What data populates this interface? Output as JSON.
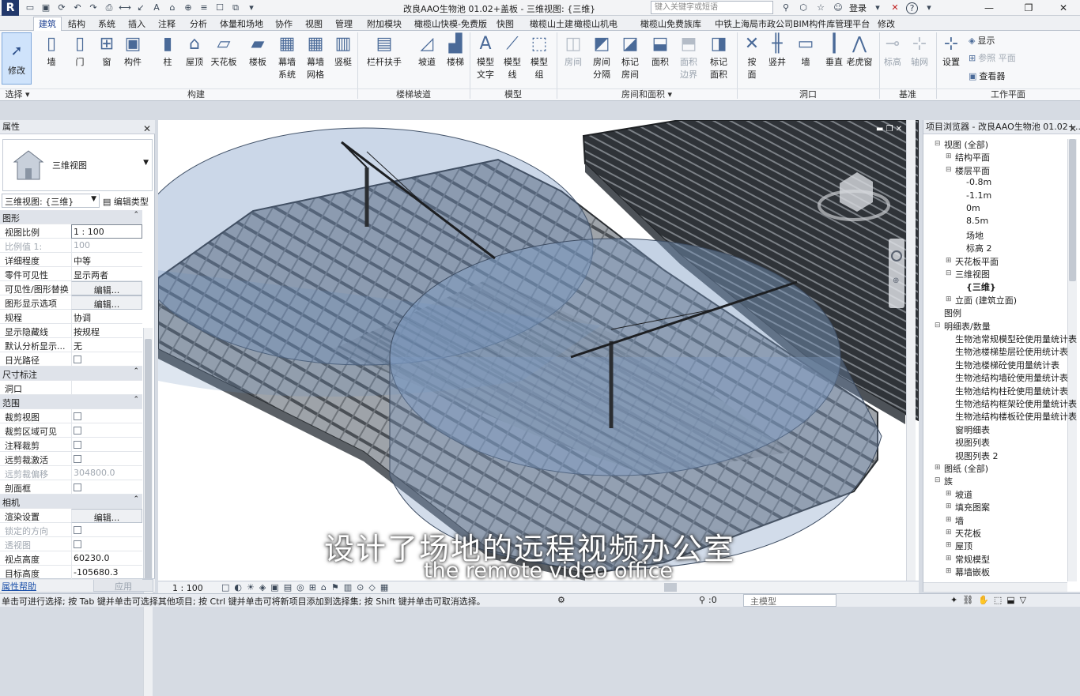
{
  "titlebar": {
    "app_letter": "R",
    "doc_title": "改良AAO生物池    01.02+盖板 - 三维视图: {三维}",
    "search_placeholder": "键入关键字或短语",
    "login": "登录",
    "help": "?"
  },
  "tabs": [
    "建筑",
    "结构",
    "系统",
    "插入",
    "注释",
    "分析",
    "体量和场地",
    "协作",
    "视图",
    "管理",
    "附加模块",
    "橄榄山快模-免费版",
    "快图",
    "橄榄山土建",
    "橄榄山机电",
    "橄榄山免费族库",
    "中铁上海局市政公司BIM构件库管理平台",
    "修改"
  ],
  "ribbon": {
    "modify": "修改",
    "select_label": "选择",
    "build": [
      {
        "label": "墙",
        "icon": "wall-icon"
      },
      {
        "label": "门",
        "icon": "door-icon"
      },
      {
        "label": "窗",
        "icon": "window-icon"
      },
      {
        "label": "构件",
        "icon": "component-icon"
      },
      {
        "label": "柱",
        "icon": "column-icon"
      },
      {
        "label": "屋顶",
        "icon": "roof-icon"
      },
      {
        "label": "天花板",
        "icon": "ceiling-icon"
      },
      {
        "label": "楼板",
        "icon": "floor-icon"
      },
      {
        "label": "幕墙\n系统",
        "icon": "curtain-system-icon"
      },
      {
        "label": "幕墙\n网格",
        "icon": "curtain-grid-icon"
      },
      {
        "label": "竖梃",
        "icon": "mullion-icon"
      }
    ],
    "build_label": "构建",
    "stairs": [
      {
        "label": "栏杆扶手",
        "icon": "railing-icon"
      },
      {
        "label": "坡道",
        "icon": "ramp-icon"
      },
      {
        "label": "楼梯",
        "icon": "stair-icon"
      }
    ],
    "stairs_label": "楼梯坡道",
    "model": [
      {
        "label": "模型\n文字",
        "icon": "model-text-icon"
      },
      {
        "label": "模型\n线",
        "icon": "model-line-icon"
      },
      {
        "label": "模型\n组",
        "icon": "model-group-icon"
      }
    ],
    "model_label": "模型",
    "room": [
      {
        "label": "房间",
        "icon": "room-icon",
        "dim": true
      },
      {
        "label": "房间\n分隔",
        "icon": "room-separator-icon",
        "dim": false
      },
      {
        "label": "标记\n房间",
        "icon": "tag-room-icon",
        "dim": false
      },
      {
        "label": "面积",
        "icon": "area-icon",
        "dim": false
      },
      {
        "label": "面积\n边界",
        "icon": "area-boundary-icon",
        "dim": true
      },
      {
        "label": "标记\n面积",
        "icon": "tag-area-icon",
        "dim": false
      }
    ],
    "room_label": "房间和面积",
    "opening": [
      {
        "label": "按\n面",
        "icon": "by-face-icon"
      },
      {
        "label": "竖井",
        "icon": "shaft-icon"
      },
      {
        "label": "墙",
        "icon": "wall-opening-icon"
      },
      {
        "label": "垂直",
        "icon": "vertical-icon"
      },
      {
        "label": "老虎窗",
        "icon": "dormer-icon"
      }
    ],
    "opening_label": "洞口",
    "datum": [
      {
        "label": "标高",
        "icon": "level-icon"
      },
      {
        "label": "轴网",
        "icon": "grid-icon"
      }
    ],
    "datum_label": "基准",
    "workplane": {
      "set": "设置",
      "show": "显示",
      "ref": "参照 平面",
      "viewer": "查看器"
    },
    "workplane_label": "工作平面"
  },
  "properties": {
    "title": "属性",
    "type_name": "三维视图",
    "type_selector": "三维视图: {三维}",
    "edit_type": "编辑类型",
    "rows": [
      {
        "k": "图形",
        "section": true
      },
      {
        "k": "视图比例",
        "v": "1 : 100",
        "input": true
      },
      {
        "k": "比例值 1:",
        "v": "100",
        "grey": true
      },
      {
        "k": "详细程度",
        "v": "中等"
      },
      {
        "k": "零件可见性",
        "v": "显示两者"
      },
      {
        "k": "可见性/图形替换",
        "v": "编辑...",
        "btn": true
      },
      {
        "k": "图形显示选项",
        "v": "编辑...",
        "btn": true
      },
      {
        "k": "规程",
        "v": "协调"
      },
      {
        "k": "显示隐藏线",
        "v": "按规程"
      },
      {
        "k": "默认分析显示...",
        "v": "无"
      },
      {
        "k": "日光路径",
        "v": "",
        "check": true
      },
      {
        "k": "尺寸标注",
        "section": true
      },
      {
        "k": "洞口",
        "v": ""
      },
      {
        "k": "范围",
        "section": true
      },
      {
        "k": "裁剪视图",
        "v": "",
        "check": true
      },
      {
        "k": "裁剪区域可见",
        "v": "",
        "check": true
      },
      {
        "k": "注释裁剪",
        "v": "",
        "check": true
      },
      {
        "k": "远剪裁激活",
        "v": "",
        "check": true
      },
      {
        "k": "远剪裁偏移",
        "v": "304800.0",
        "grey": true
      },
      {
        "k": "剖面框",
        "v": "",
        "check": true
      },
      {
        "k": "相机",
        "section": true
      },
      {
        "k": "渲染设置",
        "v": "编辑...",
        "btn": true
      },
      {
        "k": "锁定的方向",
        "v": "",
        "check": true,
        "grey": true
      },
      {
        "k": "透视图",
        "v": "",
        "check": true,
        "grey": true
      },
      {
        "k": "视点高度",
        "v": "60230.0"
      },
      {
        "k": "目标高度",
        "v": "-105680.3"
      }
    ],
    "help": "属性帮助",
    "apply": "应用"
  },
  "viewport": {
    "scale": "1 : 100"
  },
  "browser": {
    "title": "项目浏览器 - 改良AAO生物池    01.02+...",
    "items": [
      {
        "t": "视图 (全部)",
        "lv": 0,
        "tw": "−"
      },
      {
        "t": "结构平面",
        "lv": 1,
        "tw": "+"
      },
      {
        "t": "楼层平面",
        "lv": 1,
        "tw": "−"
      },
      {
        "t": "-0.8m",
        "lv": 2
      },
      {
        "t": "-1.1m",
        "lv": 2
      },
      {
        "t": "0m",
        "lv": 2
      },
      {
        "t": "8.5m",
        "lv": 2
      },
      {
        "t": "场地",
        "lv": 2
      },
      {
        "t": "标高 2",
        "lv": 2
      },
      {
        "t": "天花板平面",
        "lv": 1,
        "tw": "+"
      },
      {
        "t": "三维视图",
        "lv": 1,
        "tw": "−"
      },
      {
        "t": "{三维}",
        "lv": 2,
        "sel": true
      },
      {
        "t": "立面 (建筑立面)",
        "lv": 1,
        "tw": "+"
      },
      {
        "t": "图例",
        "lv": 0
      },
      {
        "t": "明细表/数量",
        "lv": 0,
        "tw": "−"
      },
      {
        "t": "生物池常规模型砼使用量统计表",
        "lv": 1
      },
      {
        "t": "生物池楼梯垫层砼使用统计表",
        "lv": 1
      },
      {
        "t": "生物池楼梯砼使用量统计表",
        "lv": 1
      },
      {
        "t": "生物池结构墙砼使用量统计表",
        "lv": 1
      },
      {
        "t": "生物池结构柱砼使用量统计表",
        "lv": 1
      },
      {
        "t": "生物池结构框架砼使用量统计表",
        "lv": 1
      },
      {
        "t": "生物池结构楼板砼使用量统计表",
        "lv": 1
      },
      {
        "t": "窗明细表",
        "lv": 1
      },
      {
        "t": "视图列表",
        "lv": 1
      },
      {
        "t": "视图列表 2",
        "lv": 1
      },
      {
        "t": "图纸 (全部)",
        "lv": 0,
        "tw": "+"
      },
      {
        "t": "族",
        "lv": 0,
        "tw": "−"
      },
      {
        "t": "坡道",
        "lv": 1,
        "tw": "+"
      },
      {
        "t": "填充图案",
        "lv": 1,
        "tw": "+"
      },
      {
        "t": "墙",
        "lv": 1,
        "tw": "+"
      },
      {
        "t": "天花板",
        "lv": 1,
        "tw": "+"
      },
      {
        "t": "屋顶",
        "lv": 1,
        "tw": "+"
      },
      {
        "t": "常规模型",
        "lv": 1,
        "tw": "+"
      },
      {
        "t": "幕墙嵌板",
        "lv": 1,
        "tw": "+"
      }
    ]
  },
  "status": {
    "text": "单击可进行选择; 按 Tab 键并单击可选择其他项目; 按 Ctrl 键并单击可将新项目添加到选择集; 按 Shift 键并单击可取消选择。",
    "zero": ":0",
    "main_model": "主模型"
  },
  "subtitles": {
    "cn": "设计了场地的远程视频办公室",
    "en": "the remote video office"
  },
  "colors": {
    "accent": "#1a3d8f",
    "tower_blue": "#7d9cc4"
  }
}
